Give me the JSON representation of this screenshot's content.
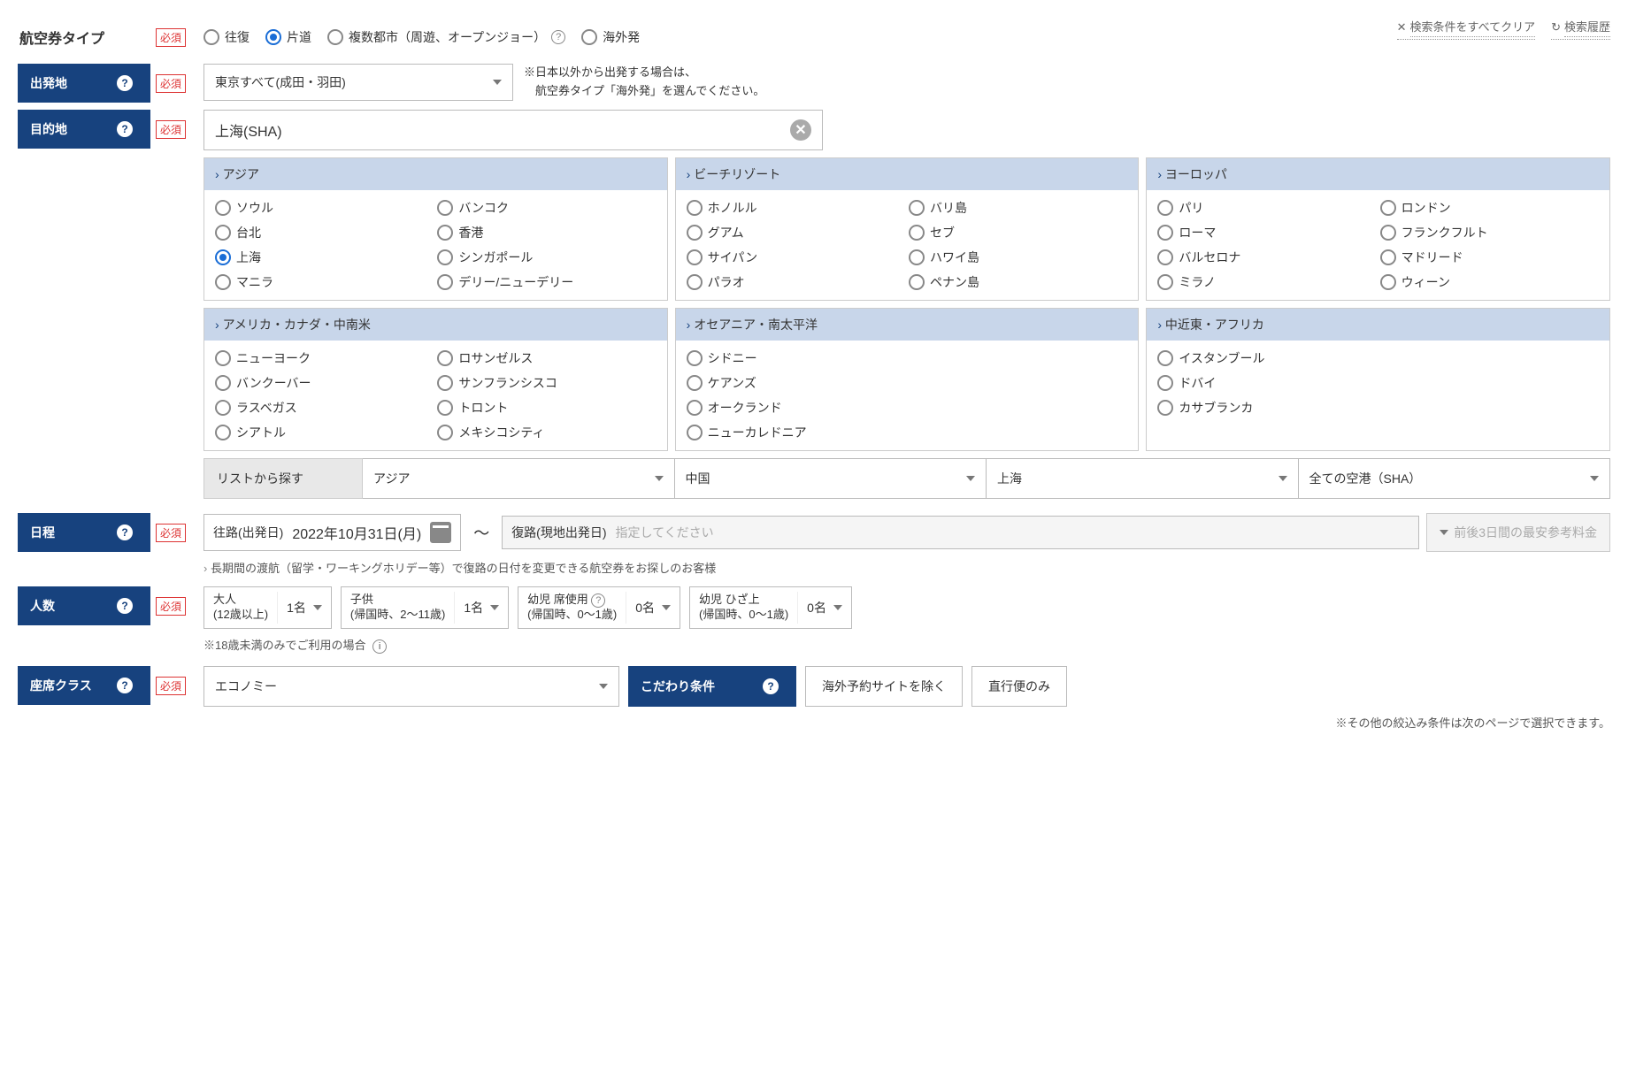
{
  "topActions": {
    "clear": "検索条件をすべてクリア",
    "history": "検索履歴"
  },
  "required": "必須",
  "ticketType": {
    "label": "航空券タイプ",
    "options": [
      "往復",
      "片道",
      "複数都市（周遊、オープンジョー）",
      "海外発"
    ],
    "selected": 1
  },
  "departure": {
    "label": "出発地",
    "value": "東京すべて(成田・羽田)",
    "note1": "※日本以外から出発する場合は、",
    "note2": "　航空券タイプ「海外発」を選んでください。"
  },
  "destination": {
    "label": "目的地",
    "value": "上海(SHA)",
    "regions": [
      {
        "name": "アジア",
        "cols": 2,
        "items": [
          "ソウル",
          "バンコク",
          "台北",
          "香港",
          "上海",
          "シンガポール",
          "マニラ",
          "デリー/ニューデリー"
        ],
        "selected": "上海"
      },
      {
        "name": "ビーチリゾート",
        "cols": 2,
        "items": [
          "ホノルル",
          "バリ島",
          "グアム",
          "セブ",
          "サイパン",
          "ハワイ島",
          "パラオ",
          "ペナン島"
        ]
      },
      {
        "name": "ヨーロッパ",
        "cols": 2,
        "items": [
          "パリ",
          "ロンドン",
          "ローマ",
          "フランクフルト",
          "バルセロナ",
          "マドリード",
          "ミラノ",
          "ウィーン"
        ]
      },
      {
        "name": "アメリカ・カナダ・中南米",
        "cols": 2,
        "items": [
          "ニューヨーク",
          "ロサンゼルス",
          "バンクーバー",
          "サンフランシスコ",
          "ラスベガス",
          "トロント",
          "シアトル",
          "メキシコシティ"
        ]
      },
      {
        "name": "オセアニア・南太平洋",
        "cols": 1,
        "items": [
          "シドニー",
          "ケアンズ",
          "オークランド",
          "ニューカレドニア"
        ]
      },
      {
        "name": "中近東・アフリカ",
        "cols": 1,
        "items": [
          "イスタンブール",
          "ドバイ",
          "カサブランカ"
        ]
      }
    ],
    "listLabel": "リストから探す",
    "listSelects": [
      "アジア",
      "中国",
      "上海",
      "全ての空港（SHA）"
    ]
  },
  "dates": {
    "label": "日程",
    "outLabel": "往路(出発日)",
    "outValue": "2022年10月31日(月)",
    "retLabel": "復路(現地出発日)",
    "retPlaceholder": "指定してください",
    "priceBtn": "前後3日間の最安参考料金",
    "longTerm": "長期間の渡航（留学・ワーキングホリデー等）で復路の日付を変更できる航空券をお探しのお客様"
  },
  "pax": {
    "label": "人数",
    "adult": {
      "l1": "大人",
      "l2": "(12歳以上)",
      "val": "1名"
    },
    "child": {
      "l1": "子供",
      "l2": "(帰国時、2～11歳)",
      "val": "1名"
    },
    "infSeat": {
      "l1": "幼児 席使用",
      "l2": "(帰国時、0～1歳)",
      "val": "0名"
    },
    "infLap": {
      "l1": "幼児 ひざ上",
      "l2": "(帰国時、0～1歳)",
      "val": "0名"
    },
    "minorNote": "※18歳未満のみでご利用の場合"
  },
  "seat": {
    "label": "座席クラス",
    "value": "エコノミー"
  },
  "kodawari": {
    "label": "こだわり条件",
    "opt1": "海外予約サイトを除く",
    "opt2": "直行便のみ"
  },
  "footNote": "※その他の絞込み条件は次のページで選択できます。"
}
